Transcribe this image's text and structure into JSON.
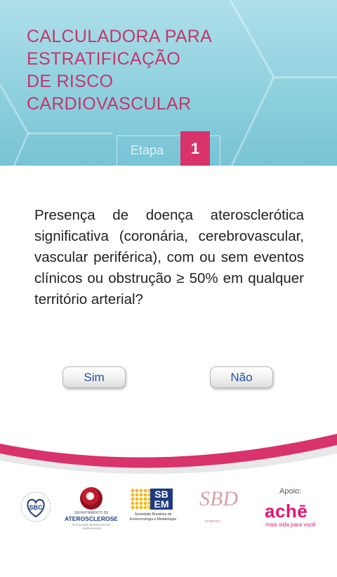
{
  "header": {
    "title_lines": [
      "CALCULADORA PARA",
      "ESTRATIFICAÇÃO",
      "DE RISCO",
      "CARDIOVASCULAR"
    ],
    "step_label": "Etapa",
    "step_number": "1"
  },
  "question": {
    "text": "Presença de doença aterosclerótica significativa (coronária, cerebrovascular, vascular periférica), com ou sem eventos clínicos ou obstrução ≥ 50% em qualquer território arterial?"
  },
  "answers": {
    "yes_label": "Sim",
    "no_label": "Não"
  },
  "footer": {
    "logos": {
      "sbc": "SBC",
      "ateros_dept": "DEPARTAMENTO DE",
      "ateros_name": "ATEROSCLEROSE",
      "ateros_sub": "SOCIEDADE BRASILEIRA DE CARDIOLOGIA",
      "sbem_top": "SB",
      "sbem_bottom": "EM",
      "sbem_caption": "Sociedade Brasileira de Endocrinologia e Metabologia",
      "sbd_letters": "SBD",
      "sbd_caption": "DIABETES"
    },
    "apoio_label": "Apoio:",
    "sponsor_name": "achē",
    "sponsor_tagline": "mais vida para você"
  },
  "colors": {
    "title": "#c0386d",
    "accent": "#d8336a",
    "button_text": "#1f4f9e",
    "header_bg": "#86cddc",
    "sponsor": "#e2166f"
  }
}
